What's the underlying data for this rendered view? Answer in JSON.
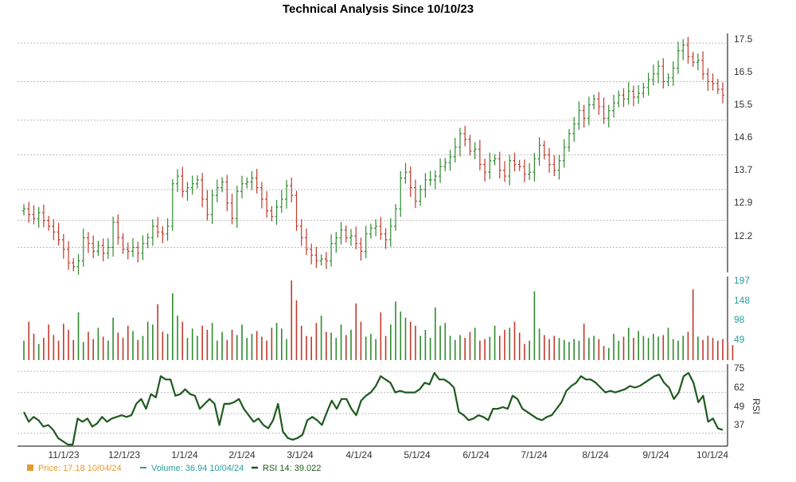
{
  "chart_data": {
    "type": "candlestick",
    "title": "Technical Analysis Since 10/10/23",
    "x_ticks": [
      "11/1/23",
      "12/1/23",
      "1/1/24",
      "2/1/24",
      "3/1/24",
      "4/1/24",
      "5/1/24",
      "6/1/24",
      "7/1/24",
      "8/1/24",
      "9/1/24",
      "10/1/24"
    ],
    "price": {
      "yticks": [
        "17.5",
        "16.5",
        "15.5",
        "14.6",
        "13.7",
        "12.9",
        "12.2"
      ],
      "ylim": [
        11.55,
        17.75
      ],
      "grid": true,
      "up_color": "#2e8b2e",
      "down_color": "#c0392b",
      "closes": [
        13.2,
        13.05,
        12.95,
        13.1,
        12.9,
        12.75,
        12.6,
        12.4,
        12.15,
        11.8,
        11.7,
        11.85,
        12.45,
        12.3,
        12.1,
        12.25,
        12.05,
        12.2,
        12.85,
        12.45,
        12.15,
        12.1,
        12.2,
        12.05,
        12.3,
        12.45,
        12.75,
        12.6,
        12.55,
        12.75,
        13.85,
        14.05,
        13.65,
        13.75,
        13.85,
        13.95,
        13.45,
        13.05,
        13.55,
        13.75,
        13.9,
        13.35,
        12.95,
        13.65,
        13.85,
        13.9,
        14.0,
        13.75,
        13.45,
        13.15,
        13.0,
        13.25,
        13.45,
        13.8,
        13.55,
        12.75,
        12.45,
        12.15,
        12.0,
        11.85,
        11.9,
        11.85,
        12.3,
        12.45,
        12.65,
        12.45,
        12.5,
        12.3,
        12.1,
        12.55,
        12.7,
        12.75,
        12.55,
        12.4,
        12.75,
        13.2,
        14.0,
        14.15,
        13.75,
        13.4,
        13.7,
        13.95,
        13.95,
        14.05,
        14.3,
        14.4,
        14.55,
        14.8,
        15.15,
        15.0,
        14.7,
        14.75,
        14.35,
        14.15,
        14.45,
        14.5,
        14.2,
        14.05,
        14.45,
        14.35,
        14.3,
        14.1,
        14.15,
        14.5,
        14.85,
        14.6,
        14.35,
        14.2,
        14.45,
        14.8,
        15.15,
        15.4,
        15.75,
        15.55,
        15.9,
        16.05,
        15.85,
        15.55,
        15.75,
        15.95,
        16.15,
        16.05,
        16.25,
        16.1,
        16.2,
        16.35,
        16.55,
        16.7,
        16.9,
        16.5,
        16.6,
        16.85,
        17.3,
        17.45,
        17.15,
        17.0,
        17.05,
        16.7,
        16.5,
        16.45,
        16.3,
        16.15
      ]
    },
    "volume": {
      "label": "Volume",
      "yticks": [
        "197",
        "148",
        "98",
        "49"
      ],
      "ylim": [
        0,
        197
      ],
      "values": [
        48,
        95,
        65,
        40,
        55,
        88,
        62,
        48,
        90,
        75,
        50,
        118,
        45,
        70,
        52,
        80,
        58,
        48,
        105,
        68,
        55,
        85,
        72,
        50,
        60,
        95,
        88,
        138,
        70,
        65,
        165,
        110,
        95,
        55,
        78,
        60,
        85,
        75,
        92,
        48,
        70,
        50,
        75,
        62,
        88,
        55,
        65,
        72,
        58,
        48,
        80,
        92,
        78,
        52,
        197,
        148,
        85,
        60,
        58,
        92,
        110,
        70,
        68,
        55,
        88,
        62,
        75,
        140,
        95,
        58,
        65,
        52,
        118,
        60,
        88,
        145,
        120,
        105,
        95,
        85,
        60,
        75,
        55,
        130,
        85,
        92,
        60,
        50,
        62,
        55,
        70,
        80,
        48,
        52,
        58,
        85,
        60,
        75,
        80,
        95,
        68,
        40,
        48,
        170,
        78,
        62,
        52,
        60,
        55,
        50,
        45,
        52,
        48,
        90,
        55,
        60,
        52,
        35,
        30,
        65,
        48,
        58,
        80,
        55,
        72,
        60,
        55,
        65,
        58,
        62,
        80,
        52,
        48,
        60,
        70,
        175,
        58,
        50,
        60,
        55,
        48,
        52,
        45,
        37
      ]
    },
    "rsi": {
      "label": "RSI",
      "yticks": [
        "75",
        "62",
        "49",
        "37"
      ],
      "ylim": [
        30,
        77
      ],
      "values": [
        50,
        44,
        47,
        45,
        41,
        42,
        39,
        34,
        32,
        30,
        30,
        46,
        44,
        46,
        41,
        43,
        47,
        44,
        46,
        47,
        48,
        47,
        48,
        55,
        58,
        52,
        61,
        59,
        72,
        70,
        70,
        60,
        61,
        64,
        61,
        60,
        52,
        55,
        58,
        55,
        42,
        55,
        55,
        56,
        58,
        52,
        48,
        44,
        46,
        42,
        40,
        45,
        55,
        38,
        34,
        33,
        34,
        36,
        45,
        47,
        45,
        42,
        50,
        57,
        52,
        58,
        58,
        52,
        48,
        57,
        60,
        62,
        66,
        72,
        70,
        68,
        62,
        63,
        62,
        62,
        62,
        64,
        68,
        67,
        74,
        70,
        70,
        68,
        65,
        50,
        48,
        45,
        46,
        48,
        47,
        45,
        52,
        52,
        53,
        52,
        60,
        58,
        52,
        50,
        48,
        46,
        45,
        47,
        48,
        52,
        56,
        63,
        66,
        68,
        72,
        70,
        70,
        68,
        65,
        62,
        63,
        62,
        63,
        64,
        66,
        65,
        66,
        68,
        70,
        72,
        73,
        68,
        65,
        58,
        62,
        72,
        74,
        68,
        56,
        60,
        44,
        46,
        40,
        39
      ]
    },
    "legend": [
      {
        "label": "Price: 17.18  10/04/24",
        "color": "#e69a2e"
      },
      {
        "label": "Volume: 36.94  10/04/24",
        "color": "#2a9d9d"
      },
      {
        "label": "RSI 14: 39.022",
        "color": "#1e5a1e"
      }
    ]
  }
}
